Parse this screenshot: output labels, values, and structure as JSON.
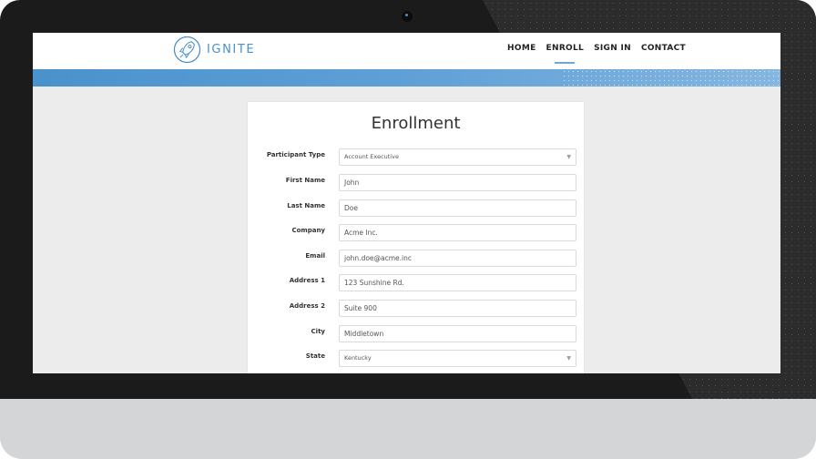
{
  "header": {
    "logo_text": "IGNITE",
    "nav": [
      {
        "label": "HOME",
        "active": false
      },
      {
        "label": "ENROLL",
        "active": true
      },
      {
        "label": "SIGN IN",
        "active": false
      },
      {
        "label": "CONTACT",
        "active": false
      }
    ]
  },
  "form": {
    "title": "Enrollment",
    "fields": [
      {
        "label": "Participant Type",
        "value": "Account Executive",
        "type": "select"
      },
      {
        "label": "First Name",
        "value": "John",
        "type": "text"
      },
      {
        "label": "Last Name",
        "value": "Doe",
        "type": "text"
      },
      {
        "label": "Company",
        "value": "Acme Inc.",
        "type": "text"
      },
      {
        "label": "Email",
        "value": "john.doe@acme.inc",
        "type": "text"
      },
      {
        "label": "Address 1",
        "value": "123 Sunshine Rd.",
        "type": "text"
      },
      {
        "label": "Address 2",
        "value": "Suite 900",
        "type": "text"
      },
      {
        "label": "City",
        "value": "Middletown",
        "type": "text"
      },
      {
        "label": "State",
        "value": "Kentucky",
        "type": "select"
      }
    ]
  },
  "colors": {
    "brand": "#4a90c8",
    "banner_start": "#4a92cc",
    "banner_end": "#85b6e0",
    "page_bg": "#ececec",
    "device_bezel": "#1b1b1b",
    "device_base": "#d3d5d6"
  }
}
